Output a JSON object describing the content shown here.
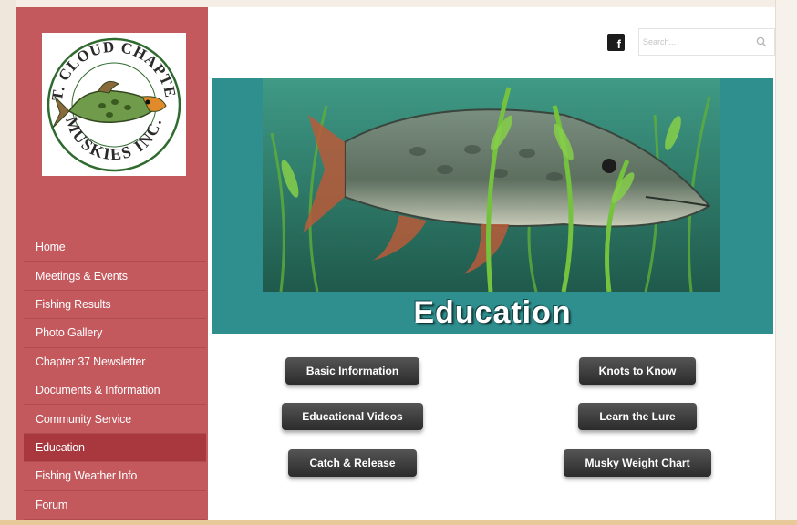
{
  "logo": {
    "top_text": "ST. CLOUD CHAPTER",
    "bottom_text": "MUSKIES INC."
  },
  "sidebar": {
    "items": [
      {
        "label": "Home"
      },
      {
        "label": "Meetings & Events"
      },
      {
        "label": "Fishing Results"
      },
      {
        "label": "Photo Gallery"
      },
      {
        "label": "Chapter 37 Newsletter"
      },
      {
        "label": "Documents & Information"
      },
      {
        "label": "Community Service"
      },
      {
        "label": "Education"
      },
      {
        "label": "Fishing Weather Info"
      },
      {
        "label": "Forum"
      }
    ],
    "active": "Education"
  },
  "header": {
    "facebook_icon": "facebook-icon",
    "facebook_glyph": "f",
    "search": {
      "placeholder": "Search...",
      "value": ""
    }
  },
  "banner": {
    "title": "Education"
  },
  "buttons": {
    "basic_information": "Basic Information",
    "knots_to_know": "Knots to Know",
    "educational_videos": "Educational Videos",
    "learn_the_lure": "Learn the Lure",
    "catch_release": "Catch & Release",
    "musky_weight_chart": "Musky Weight Chart"
  },
  "colors": {
    "sidebar": "#c3585d",
    "sidebar_active": "#a8383e",
    "banner": "#2f8f8f",
    "button": "#333333"
  }
}
